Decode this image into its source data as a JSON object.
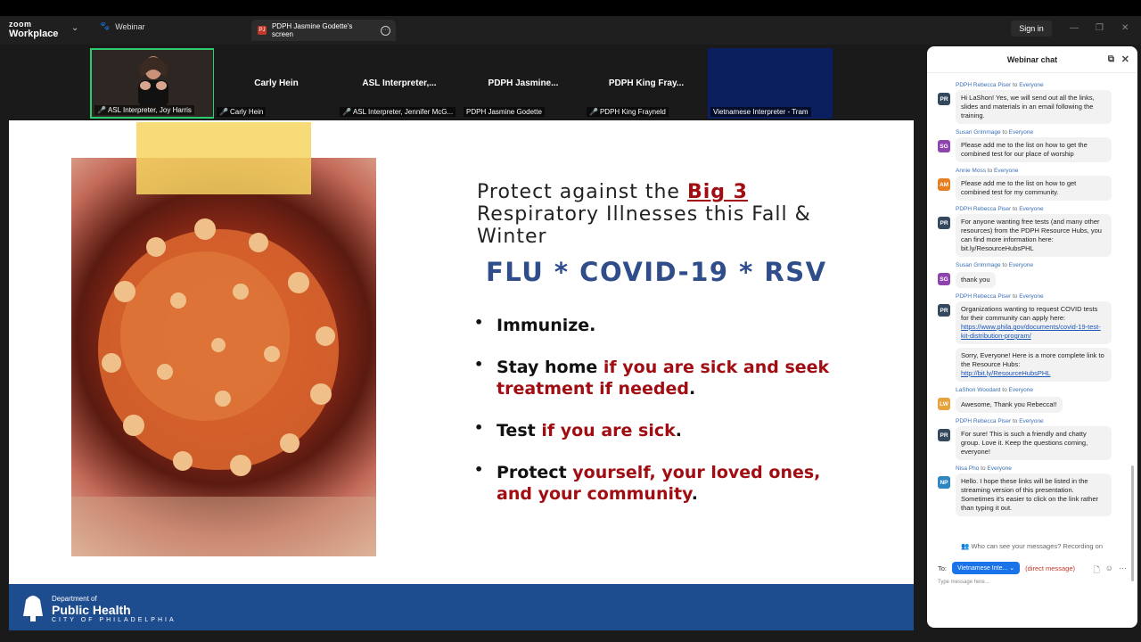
{
  "app": {
    "brand_top": "zoom",
    "brand_bottom": "Workplace",
    "mode_tab": "Webinar",
    "screen_tab": "PDPH Jasmine Godette's screen",
    "screen_tab_badge": "PJ",
    "sign_in": "Sign in"
  },
  "gallery": [
    {
      "name": "",
      "label": "ASL Interpreter, Joy Harris",
      "type": "video"
    },
    {
      "name": "Carly Hein",
      "label": "Carly Hein",
      "type": "name"
    },
    {
      "name": "ASL Interpreter,...",
      "label": "ASL Interpreter, Jennifer McG...",
      "type": "name"
    },
    {
      "name": "PDPH Jasmine...",
      "label": "PDPH Jasmine Godette",
      "type": "name"
    },
    {
      "name": "PDPH King Fray...",
      "label": "PDPH King Frayneld",
      "type": "name"
    },
    {
      "name": "",
      "label": "Vietnamese Interpreter - Tram",
      "type": "navy"
    }
  ],
  "slide": {
    "title_pre": "Protect against the ",
    "title_big3": "Big 3",
    "title_post": "Respiratory Illnesses this Fall & Winter",
    "subtitle": "FLU * COVID-19 * RSV",
    "bullets": [
      {
        "black": "Immunize.",
        "red": "",
        "end": ""
      },
      {
        "black": "Stay home ",
        "red": "if you are sick and seek treatment if needed",
        "end": "."
      },
      {
        "black": "Test ",
        "red": "if you are sick",
        "end": "."
      },
      {
        "black": "Protect ",
        "red": "yourself, your loved ones, and your community",
        "end": "."
      }
    ],
    "footer_dept": "Department of",
    "footer_title": "Public Health",
    "footer_city": "CITY OF PHILADELPHIA"
  },
  "chat": {
    "title": "Webinar chat",
    "messages": [
      {
        "from": "PDPH Rebecca Piser",
        "to": "Everyone",
        "initials": "PR",
        "color": "#34495e",
        "texts": [
          "Hi LaShon! Yes, we will send out all the links, slides and materials in an email following the training."
        ]
      },
      {
        "from": "Susan Grimmage",
        "to": "Everyone",
        "initials": "SG",
        "color": "#8e44ad",
        "texts": [
          "Please add me to the list on how to get the combined test for our place of worship"
        ]
      },
      {
        "from": "Annie Moss",
        "to": "Everyone",
        "initials": "AM",
        "color": "#e67e22",
        "texts": [
          "Please add me to the list on how to get combined test for my community."
        ]
      },
      {
        "from": "PDPH Rebecca Piser",
        "to": "Everyone",
        "initials": "PR",
        "color": "#34495e",
        "texts": [
          "For anyone wanting free tests (and many other resources) from the PDPH Resource Hubs, you can find more information here: bit.ly/ResourceHubsPHL"
        ]
      },
      {
        "from": "Susan Grimmage",
        "to": "Everyone",
        "initials": "SG",
        "color": "#8e44ad",
        "texts": [
          "thank you"
        ]
      },
      {
        "from": "PDPH Rebecca Piser",
        "to": "Everyone",
        "initials": "PR",
        "color": "#34495e",
        "texts": [
          "Organizations wanting to request COVID tests for their community can apply here:"
        ],
        "link1": "https://www.phila.gov/documents/covid-19-test-kit-distribution-program/",
        "text2": "Sorry, Everyone! Here is a more complete link to the Resource Hubs:",
        "link2": "http://bit.ly/ResourceHubsPHL"
      },
      {
        "from": "LaShon Woodard",
        "to": "Everyone",
        "initials": "LW",
        "color": "#e6a23c",
        "texts": [
          "Awesome, Thank you Rebecca!!"
        ]
      },
      {
        "from": "PDPH Rebecca Piser",
        "to": "Everyone",
        "initials": "PR",
        "color": "#34495e",
        "texts": [
          "For sure! This is such a friendly and chatty group. Love it. Keep the questions coming, everyone!"
        ]
      },
      {
        "from": "Nisa Pho",
        "to": "Everyone",
        "initials": "NP",
        "color": "#2e86c1",
        "texts": [
          "Hello. I hope these links will be listed in the streaming version of this presentation. Sometimes it's easier to click on the link rather than typing it out."
        ]
      }
    ],
    "who_can_see": "Who can see your messages? Recording on",
    "to_label": "To:",
    "to_value": "Vietnamese Inte...",
    "direct": "(direct message)",
    "placeholder": "Type message here..."
  }
}
